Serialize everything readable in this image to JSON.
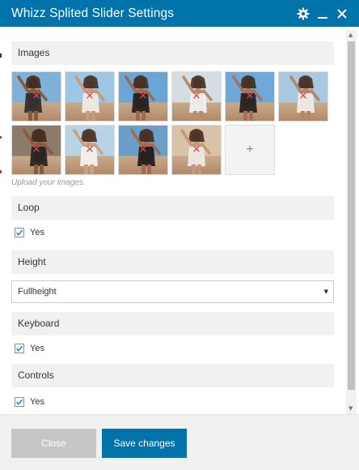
{
  "window": {
    "title": "Whizz Splited Slider Settings",
    "controls": [
      {
        "name": "gear-icon"
      },
      {
        "name": "minimize-icon"
      },
      {
        "name": "close-icon"
      }
    ]
  },
  "images": {
    "heading": "Images",
    "rows": [
      [
        {
          "sky": "#7fb0d8",
          "skin": "#8a5a3e",
          "cloth": "#2b2b2b"
        },
        {
          "sky": "#9cc6e4",
          "skin": "#c89a7b",
          "cloth": "#f2efe9"
        },
        {
          "sky": "#6aa5d6",
          "skin": "#a06a4a",
          "cloth": "#1c1c1c"
        },
        {
          "sky": "#d5dde4",
          "skin": "#b98a6c",
          "cloth": "#f4f4f4"
        },
        {
          "sky": "#6fa9d9",
          "skin": "#a5715a",
          "cloth": "#1e1e1e"
        },
        {
          "sky": "#a9c9e3",
          "skin": "#b88567",
          "cloth": "#f3f1ec"
        }
      ],
      [
        {
          "sky": "#8c7a6a",
          "skin": "#8a5a3e",
          "cloth": "#1f1f1f"
        },
        {
          "sky": "#b8d2e6",
          "skin": "#caa07f",
          "cloth": "#f5f5f5"
        },
        {
          "sky": "#6b9ec9",
          "skin": "#a56c4b",
          "cloth": "#1a1a1a"
        },
        {
          "sky": "#d8c2a8",
          "skin": "#c59878",
          "cloth": "#f0ede8"
        }
      ]
    ],
    "add_label": "+",
    "hint": "Upload your images."
  },
  "loop": {
    "heading": "Loop",
    "label": "Yes",
    "checked": true
  },
  "height": {
    "heading": "Height",
    "selected": "Fullheight"
  },
  "keyboard": {
    "heading": "Keyboard",
    "label": "Yes",
    "checked": true
  },
  "controls_setting": {
    "heading": "Controls",
    "label": "Yes",
    "checked": true
  },
  "footer": {
    "close_label": "Close",
    "save_label": "Save changes"
  },
  "colors": {
    "accent": "#0073aa",
    "remove_mark": "#e63c5a",
    "add_mark": "#46b450",
    "close_button": "#c6c6c6"
  }
}
